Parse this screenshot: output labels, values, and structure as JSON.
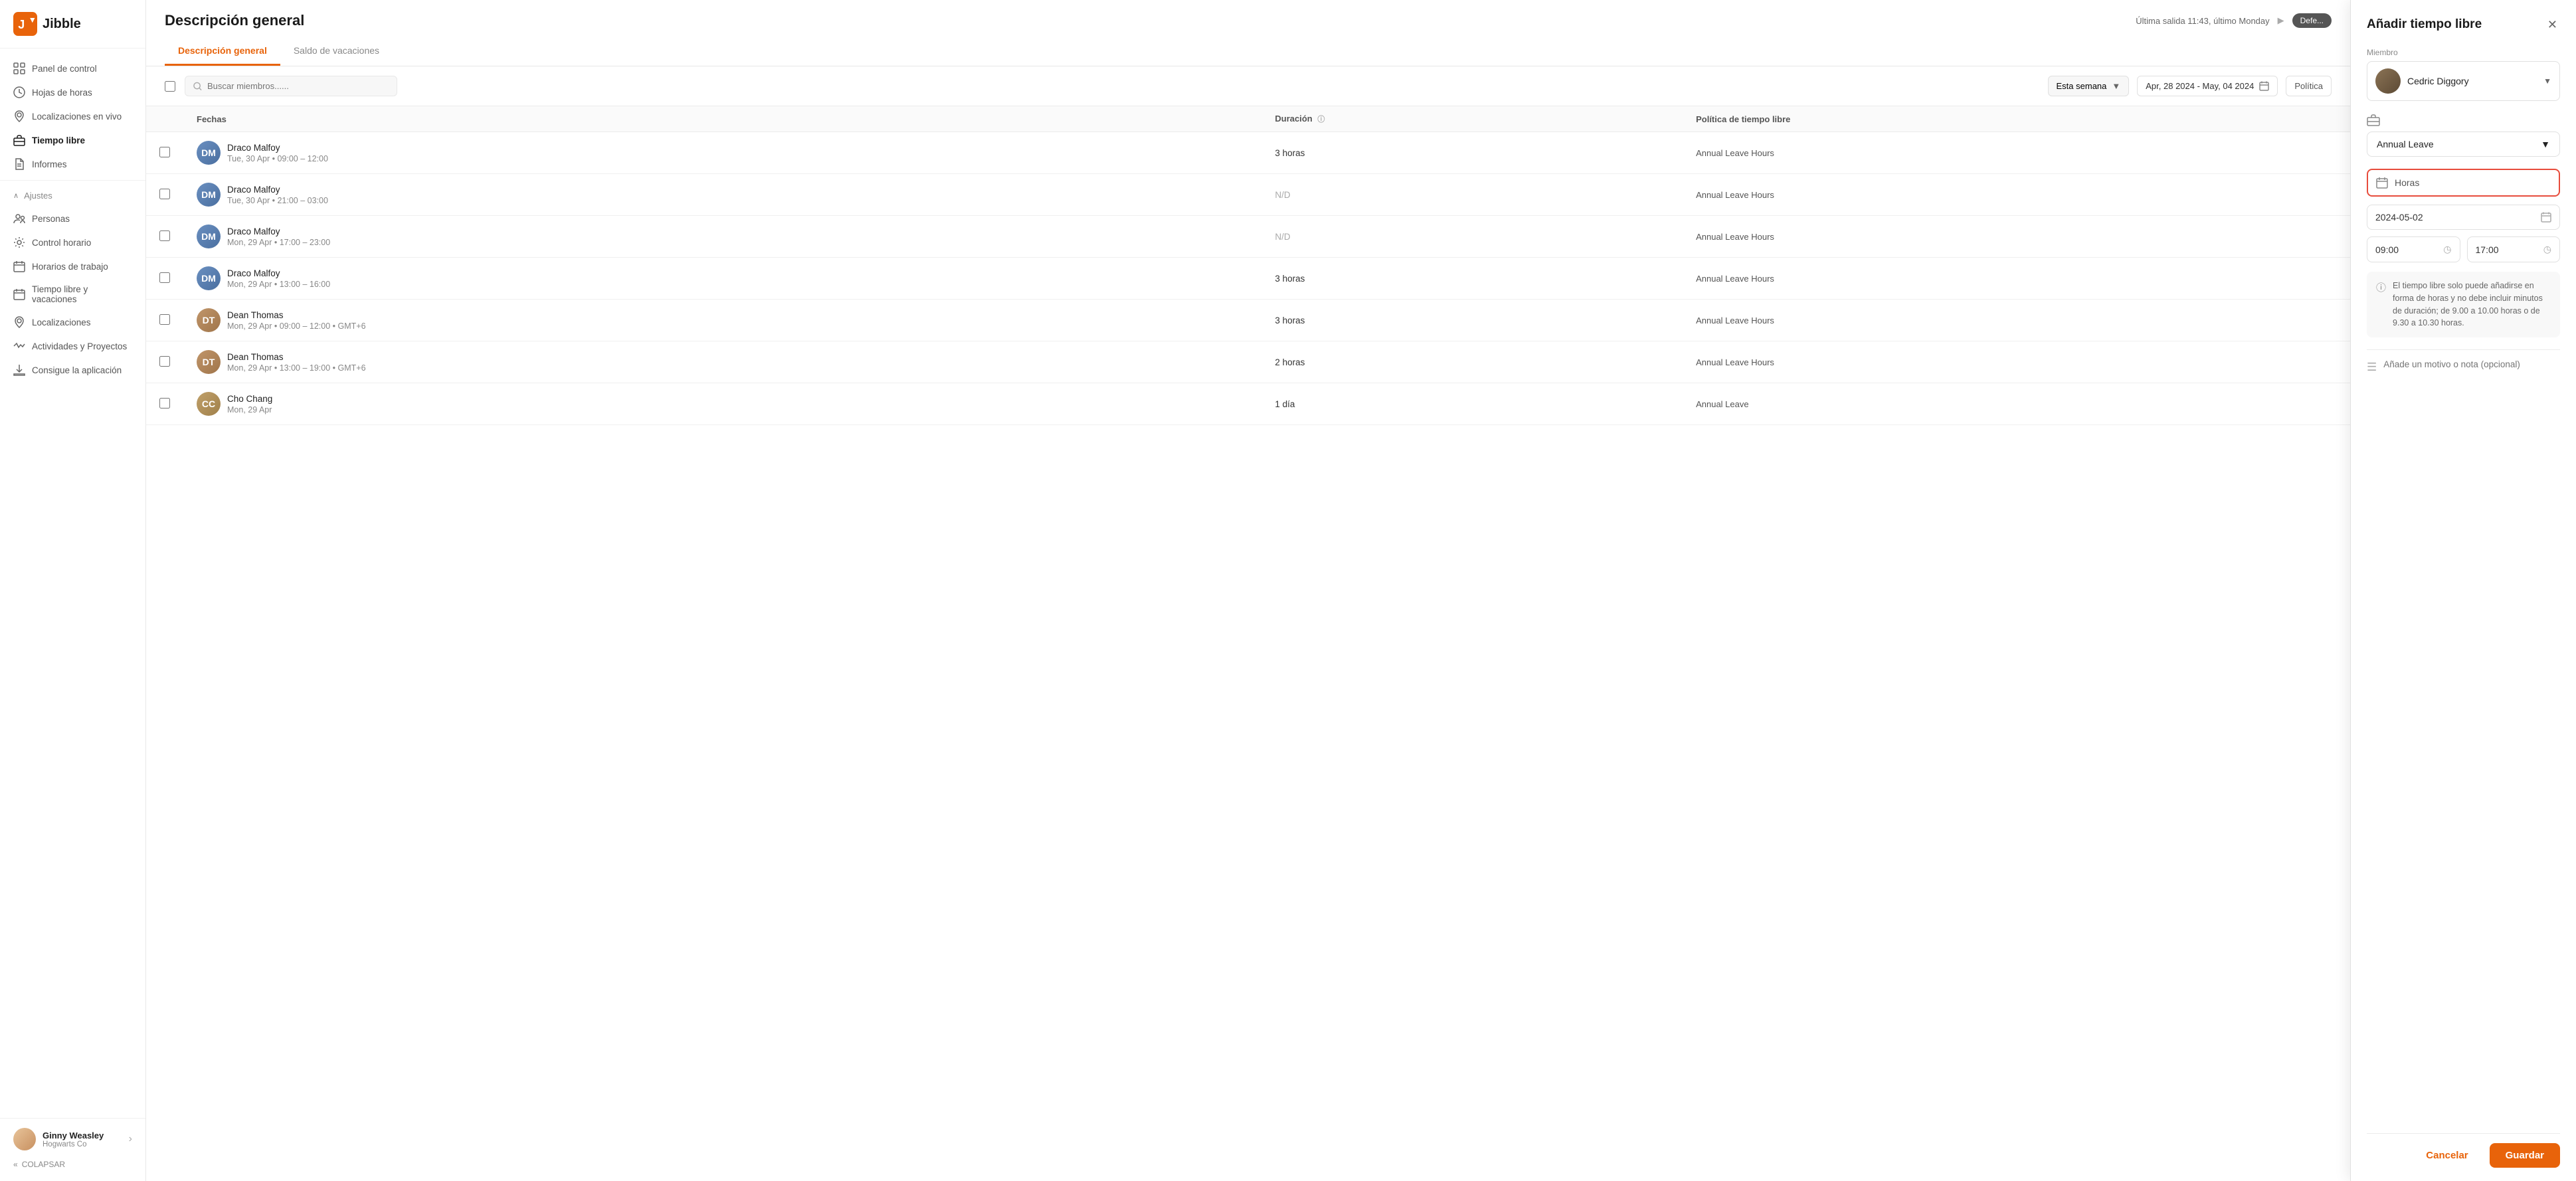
{
  "sidebar": {
    "logo_text": "Jibble",
    "nav_items": [
      {
        "id": "panel",
        "label": "Panel de control",
        "icon": "grid"
      },
      {
        "id": "hojas",
        "label": "Hojas de horas",
        "icon": "clock"
      },
      {
        "id": "localizaciones-vivo",
        "label": "Localizaciones en vivo",
        "icon": "location"
      },
      {
        "id": "tiempo-libre",
        "label": "Tiempo libre",
        "icon": "briefcase",
        "active": true
      },
      {
        "id": "informes",
        "label": "Informes",
        "icon": "document"
      }
    ],
    "section_ajustes": "Ajustes",
    "ajustes_items": [
      {
        "id": "personas",
        "label": "Personas",
        "icon": "people"
      },
      {
        "id": "control",
        "label": "Control horario",
        "icon": "control"
      },
      {
        "id": "horarios",
        "label": "Horarios de trabajo",
        "icon": "schedule"
      },
      {
        "id": "tiempo-vacaciones",
        "label": "Tiempo libre y vacaciones",
        "icon": "calendar"
      },
      {
        "id": "localizaciones",
        "label": "Localizaciones",
        "icon": "map"
      },
      {
        "id": "actividades",
        "label": "Actividades y Proyectos",
        "icon": "activity"
      },
      {
        "id": "app",
        "label": "Consigue la aplicación",
        "icon": "download"
      }
    ],
    "user": {
      "name": "Ginny Weasley",
      "company": "Hogwarts Co",
      "chevron": "›"
    },
    "collapse_label": "COLAPSAR"
  },
  "header": {
    "title": "Descripción general",
    "last_sync": "Última salida 11:43, último Monday",
    "defer_label": "Defe...",
    "tabs": [
      {
        "id": "overview",
        "label": "Descripción general",
        "active": true
      },
      {
        "id": "balance",
        "label": "Saldo de vacaciones",
        "active": false
      }
    ]
  },
  "toolbar": {
    "search_placeholder": "Buscar miembros......",
    "week_label": "Esta semana",
    "date_range": "Apr, 28 2024 - May, 04 2024",
    "politica_label": "Política"
  },
  "table": {
    "columns": [
      "",
      "Fechas",
      "Duración",
      "Política de tiempo libre"
    ],
    "rows": [
      {
        "id": 1,
        "member": "Draco Malfoy",
        "dates": "Tue, 30 Apr • 09:00 – 12:00",
        "duration": "3 horas",
        "policy": "Annual Leave Hours",
        "avatar_class": "av-draco"
      },
      {
        "id": 2,
        "member": "Draco Malfoy",
        "dates": "Tue, 30 Apr • 21:00 – 03:00",
        "duration": "N/D",
        "policy": "Annual Leave Hours",
        "avatar_class": "av-draco"
      },
      {
        "id": 3,
        "member": "Draco Malfoy",
        "dates": "Mon, 29 Apr • 17:00 – 23:00",
        "duration": "N/D",
        "policy": "Annual Leave Hours",
        "avatar_class": "av-draco"
      },
      {
        "id": 4,
        "member": "Draco Malfoy",
        "dates": "Mon, 29 Apr • 13:00 – 16:00",
        "duration": "3 horas",
        "policy": "Annual Leave Hours",
        "avatar_class": "av-draco"
      },
      {
        "id": 5,
        "member": "Dean Thomas",
        "dates": "Mon, 29 Apr • 09:00 – 12:00 • GMT+6",
        "duration": "3 horas",
        "policy": "Annual Leave Hours",
        "avatar_class": "av-dean"
      },
      {
        "id": 6,
        "member": "Dean Thomas",
        "dates": "Mon, 29 Apr • 13:00 – 19:00 • GMT+6",
        "duration": "2 horas",
        "policy": "Annual Leave Hours",
        "avatar_class": "av-dean"
      },
      {
        "id": 7,
        "member": "Cho Chang",
        "dates": "Mon, 29 Apr",
        "duration": "1 día",
        "policy": "Annual Leave",
        "avatar_class": "av-cho"
      }
    ]
  },
  "panel": {
    "title": "Añadir tiempo libre",
    "member_label": "Miembro",
    "member_name": "Cedric Diggory",
    "leave_type_label": "Annual Leave",
    "mode_label": "Horas",
    "date_value": "2024-05-02",
    "time_start": "09:00",
    "time_end": "17:00",
    "info_text": "El tiempo libre solo puede añadirse en forma de horas y no debe incluir minutos de duración; de 9.00 a 10.00 horas o de 9.30 a 10.30 horas.",
    "note_placeholder": "Añade un motivo o nota (opcional)",
    "cancel_label": "Cancelar",
    "save_label": "Guardar"
  }
}
